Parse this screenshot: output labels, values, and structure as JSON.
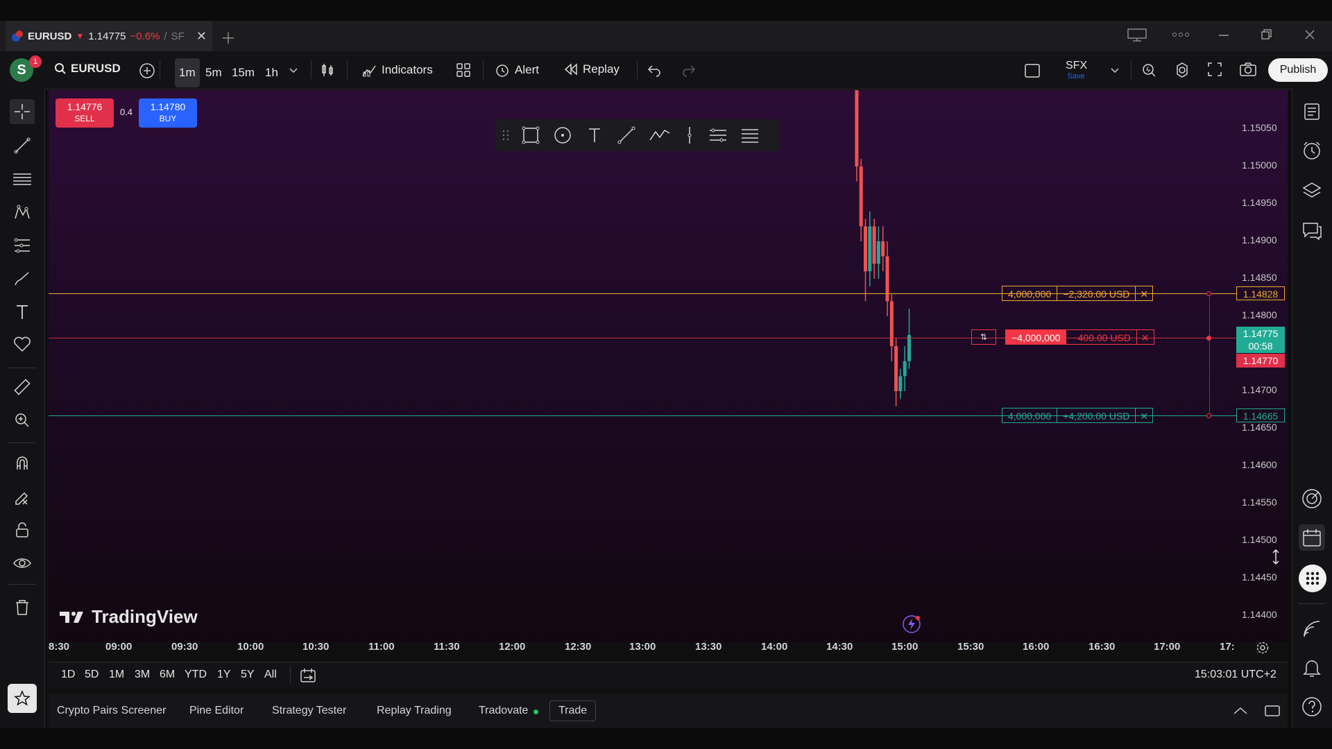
{
  "tab": {
    "symbol": "EURUSD",
    "arrow": "▼",
    "price": "1.14775",
    "change": "−0.6%",
    "sep": "/",
    "extra": "SF",
    "notif_count": "1",
    "avatar": "S"
  },
  "toolbar": {
    "symbol": "EURUSD",
    "intervals": [
      "1m",
      "5m",
      "15m",
      "1h"
    ],
    "active_interval": "1m",
    "indicators": "Indicators",
    "alert": "Alert",
    "replay": "Replay",
    "layout_name": "SFX",
    "layout_save": "Save",
    "publish": "Publish"
  },
  "quote": {
    "sell_price": "1.14776",
    "sell_label": "SELL",
    "spread": "0.4",
    "buy_price": "1.14780",
    "buy_label": "BUY"
  },
  "price_axis": [
    "1.15050",
    "1.15000",
    "1.14950",
    "1.14900",
    "1.14850",
    "1.14800",
    "1.14700",
    "1.14650",
    "1.14600",
    "1.14550",
    "1.14500",
    "1.14450",
    "1.14400"
  ],
  "time_axis": [
    "8:30",
    "09:00",
    "09:30",
    "10:00",
    "10:30",
    "11:00",
    "11:30",
    "12:00",
    "12:30",
    "13:00",
    "13:30",
    "14:00",
    "14:30",
    "15:00",
    "15:30",
    "16:00",
    "16:30",
    "17:00",
    "17:"
  ],
  "orders": [
    {
      "qty": "4,000,000",
      "pnl": "−2,320.00 USD",
      "price": "1.14828",
      "color": "#f0a830",
      "kind": "stop"
    },
    {
      "qty": "−4,000,000",
      "pnl": "−400.00 USD",
      "price": "1.14770",
      "color": "#f23645",
      "kind": "position"
    },
    {
      "qty": "4,000,000",
      "pnl": "+4,200.00 USD",
      "price": "1.14665",
      "color": "#22ab94",
      "kind": "target"
    }
  ],
  "last_price": {
    "price": "1.14775",
    "countdown": "00:58",
    "color": "#22ab94"
  },
  "watermark": "TradingView",
  "ranges": [
    "1D",
    "5D",
    "1M",
    "3M",
    "6M",
    "YTD",
    "1Y",
    "5Y",
    "All"
  ],
  "clock": "15:03:01 UTC+2",
  "panel_tabs": [
    "Crypto Pairs Screener",
    "Pine Editor",
    "Strategy Tester",
    "Replay Trading",
    "Tradovate",
    "Trade"
  ],
  "chart_data": {
    "type": "candlestick",
    "x_range": [
      "08:30",
      "17:30"
    ],
    "ylim": [
      1.144,
      1.151
    ],
    "series": [
      {
        "t": "14:36",
        "o": 1.1512,
        "h": 1.1513,
        "l": 1.1498,
        "c": 1.15
      },
      {
        "t": "14:38",
        "o": 1.15,
        "h": 1.1501,
        "l": 1.149,
        "c": 1.1492
      },
      {
        "t": "14:40",
        "o": 1.1492,
        "h": 1.1493,
        "l": 1.1482,
        "c": 1.1486
      },
      {
        "t": "14:42",
        "o": 1.1486,
        "h": 1.1494,
        "l": 1.1484,
        "c": 1.1492
      },
      {
        "t": "14:44",
        "o": 1.1492,
        "h": 1.1493,
        "l": 1.1485,
        "c": 1.1487
      },
      {
        "t": "14:46",
        "o": 1.1487,
        "h": 1.1492,
        "l": 1.1485,
        "c": 1.149
      },
      {
        "t": "14:48",
        "o": 1.149,
        "h": 1.1492,
        "l": 1.1486,
        "c": 1.1488
      },
      {
        "t": "14:50",
        "o": 1.1488,
        "h": 1.149,
        "l": 1.148,
        "c": 1.1482
      },
      {
        "t": "14:52",
        "o": 1.1482,
        "h": 1.1483,
        "l": 1.1474,
        "c": 1.1476
      },
      {
        "t": "14:54",
        "o": 1.1476,
        "h": 1.1477,
        "l": 1.1468,
        "c": 1.147
      },
      {
        "t": "14:56",
        "o": 1.147,
        "h": 1.1473,
        "l": 1.1469,
        "c": 1.1472
      },
      {
        "t": "14:58",
        "o": 1.1472,
        "h": 1.1476,
        "l": 1.147,
        "c": 1.1474
      },
      {
        "t": "15:00",
        "o": 1.1474,
        "h": 1.1481,
        "l": 1.1473,
        "c": 1.14775
      }
    ]
  }
}
